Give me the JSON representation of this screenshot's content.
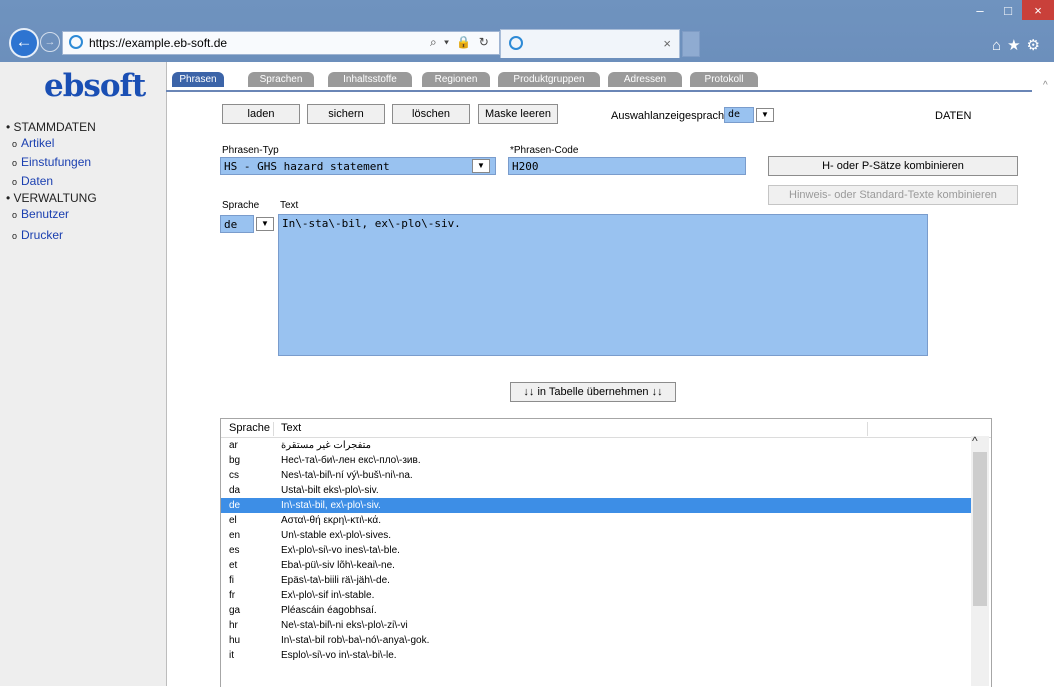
{
  "browser": {
    "url": "https://example.eb-soft.de",
    "address_controls": "⌕ ▾ 🔒 ↻",
    "tab_close": "×",
    "right_tools": "⌂★⚙",
    "win_minimize": "–",
    "win_maximize": "□",
    "win_close": "×"
  },
  "sidebar": {
    "logo": "ebsoft",
    "groups": [
      {
        "label": "STAMMDATEN",
        "items": [
          "Artikel",
          "Einstufungen",
          "Daten"
        ]
      },
      {
        "label": "VERWALTUNG",
        "items": [
          "Benutzer",
          "Drucker"
        ]
      }
    ]
  },
  "tabs": [
    "Phrasen",
    "Sprachen",
    "Inhaltsstoffe",
    "Regionen",
    "Produktgruppen",
    "Adressen",
    "Protokoll"
  ],
  "toolbar": {
    "laden": "laden",
    "sichern": "sichern",
    "loeschen": "löschen",
    "maske_leeren": "Maske leeren",
    "auswahl_label": "Auswahlanzeigesprache:",
    "auswahl_value": "de",
    "daten_label": "DATEN"
  },
  "form": {
    "phrasen_typ_label": "Phrasen-Typ",
    "phrasen_typ_value": "HS - GHS hazard statement",
    "phrasen_code_label": "*Phrasen-Code",
    "phrasen_code_value": "H200",
    "combine_hp_button": "H- oder P-Sätze kombinieren",
    "combine_hint_button": "Hinweis- oder Standard-Texte kombinieren",
    "sprache_label": "Sprache",
    "sprache_value": "de",
    "text_label": "Text",
    "text_value": "In\\-sta\\-bil, ex\\-plo\\-siv.",
    "uebernehmen_button": "↓↓ in Tabelle übernehmen ↓↓"
  },
  "grid": {
    "headers": [
      "Sprache",
      "Text"
    ],
    "rows": [
      [
        "ar",
        "متفجرات غير مستقرة"
      ],
      [
        "bg",
        "Нес\\-та\\-би\\-лен екс\\-пло\\-зив."
      ],
      [
        "cs",
        "Nes\\-ta\\-bil\\-ní vý\\-buš\\-ni\\-na."
      ],
      [
        "da",
        "Usta\\-bilt eks\\-plo\\-siv."
      ],
      [
        "de",
        "In\\-sta\\-bil, ex\\-plo\\-siv."
      ],
      [
        "el",
        "Αστα\\-θή εκρη\\-κτι\\-κά."
      ],
      [
        "en",
        "Un\\-stable ex\\-plo\\-sives."
      ],
      [
        "es",
        "Ex\\-plo\\-si\\-vo ines\\-ta\\-ble."
      ],
      [
        "et",
        "Eba\\-pü\\-siv lõh\\-keai\\-ne."
      ],
      [
        "fi",
        "Epäs\\-ta\\-biili rä\\-jäh\\-de."
      ],
      [
        "fr",
        "Ex\\-plo\\-sif in\\-stable."
      ],
      [
        "ga",
        "Pléascáin éagobhsaí."
      ],
      [
        "hr",
        "Ne\\-sta\\-bil\\-ni eks\\-plo\\-zi\\-vi"
      ],
      [
        "hu",
        "In\\-sta\\-bil rob\\-ba\\-nó\\-anya\\-gok."
      ],
      [
        "it",
        "Esplo\\-si\\-vo in\\-sta\\-bi\\-le."
      ]
    ],
    "selected_index": 4
  }
}
